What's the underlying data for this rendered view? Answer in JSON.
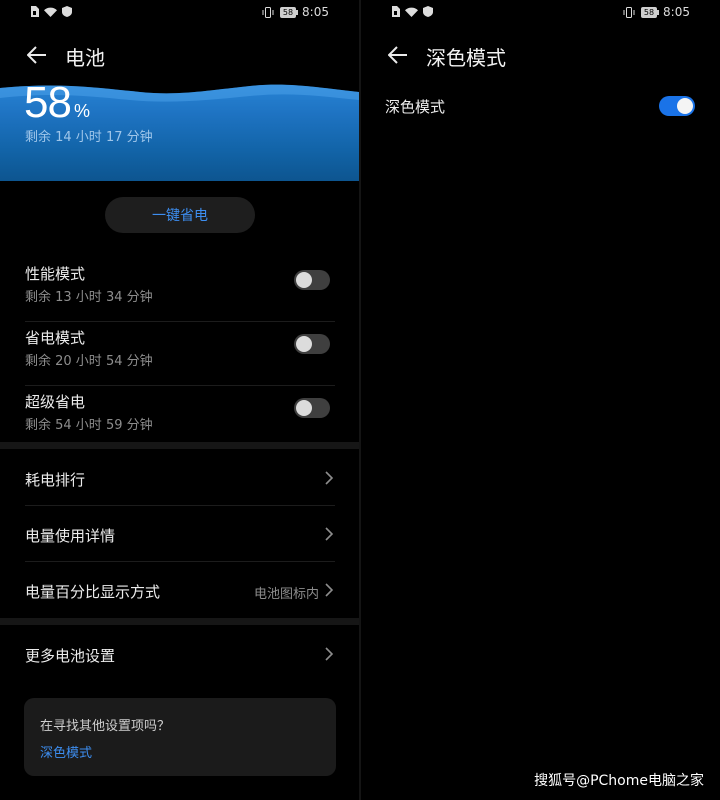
{
  "status_bar": {
    "time": "8:05",
    "battery_level": "58"
  },
  "battery_screen": {
    "title": "电池",
    "percent": "58",
    "percent_sign": "%",
    "remaining": "剩余 14 小时 17 分钟",
    "one_click_save": "一键省电",
    "modes": [
      {
        "title": "性能模式",
        "remaining": "剩余 13 小时 34 分钟",
        "enabled": false
      },
      {
        "title": "省电模式",
        "remaining": "剩余 20 小时 54 分钟",
        "enabled": false
      },
      {
        "title": "超级省电",
        "remaining": "剩余 54 小时 59 分钟",
        "enabled": false
      }
    ],
    "list": [
      {
        "label": "耗电排行",
        "value": ""
      },
      {
        "label": "电量使用详情",
        "value": ""
      },
      {
        "label": "电量百分比显示方式",
        "value": "电池图标内"
      }
    ],
    "more_settings": "更多电池设置",
    "suggestion": {
      "question": "在寻找其他设置项吗？",
      "link": "深色模式"
    }
  },
  "dark_mode_screen": {
    "title": "深色模式",
    "toggle_label": "深色模式",
    "enabled": true
  },
  "watermark": "搜狐号@PChome电脑之家",
  "colors": {
    "accent": "#3d8ef0",
    "hero_blue": "#1e73c2",
    "background": "#000000",
    "toggle_on": "#1a73e8"
  }
}
